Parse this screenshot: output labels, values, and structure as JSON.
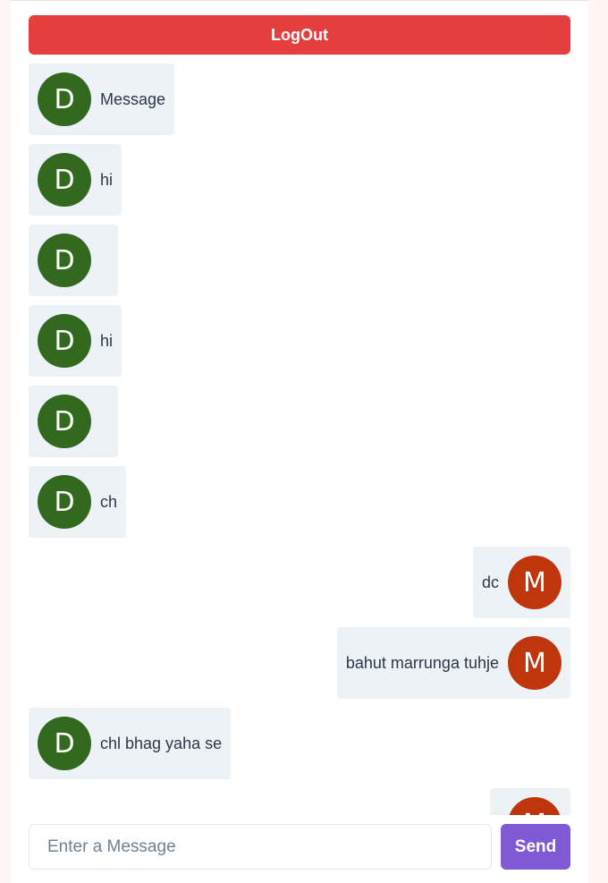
{
  "header": {
    "logout_label": "LogOut"
  },
  "colors": {
    "logout_bg": "#e53e3e",
    "send_bg": "#805ad5",
    "bubble_bg": "#edf2f7",
    "avatar_d": "#33691e",
    "avatar_m": "#bf360c"
  },
  "messages": [
    {
      "side": "left",
      "initial": "D",
      "text": "Message"
    },
    {
      "side": "left",
      "initial": "D",
      "text": "hi"
    },
    {
      "side": "left",
      "initial": "D",
      "text": ""
    },
    {
      "side": "left",
      "initial": "D",
      "text": "hi"
    },
    {
      "side": "left",
      "initial": "D",
      "text": ""
    },
    {
      "side": "left",
      "initial": "D",
      "text": "ch"
    },
    {
      "side": "right",
      "initial": "M",
      "text": "dc"
    },
    {
      "side": "right",
      "initial": "M",
      "text": "bahut marrunga tuhje"
    },
    {
      "side": "left",
      "initial": "D",
      "text": "chl bhag yaha se"
    },
    {
      "side": "right",
      "initial": "M",
      "text": ""
    }
  ],
  "composer": {
    "placeholder": "Enter a Message",
    "value": "",
    "send_label": "Send"
  }
}
